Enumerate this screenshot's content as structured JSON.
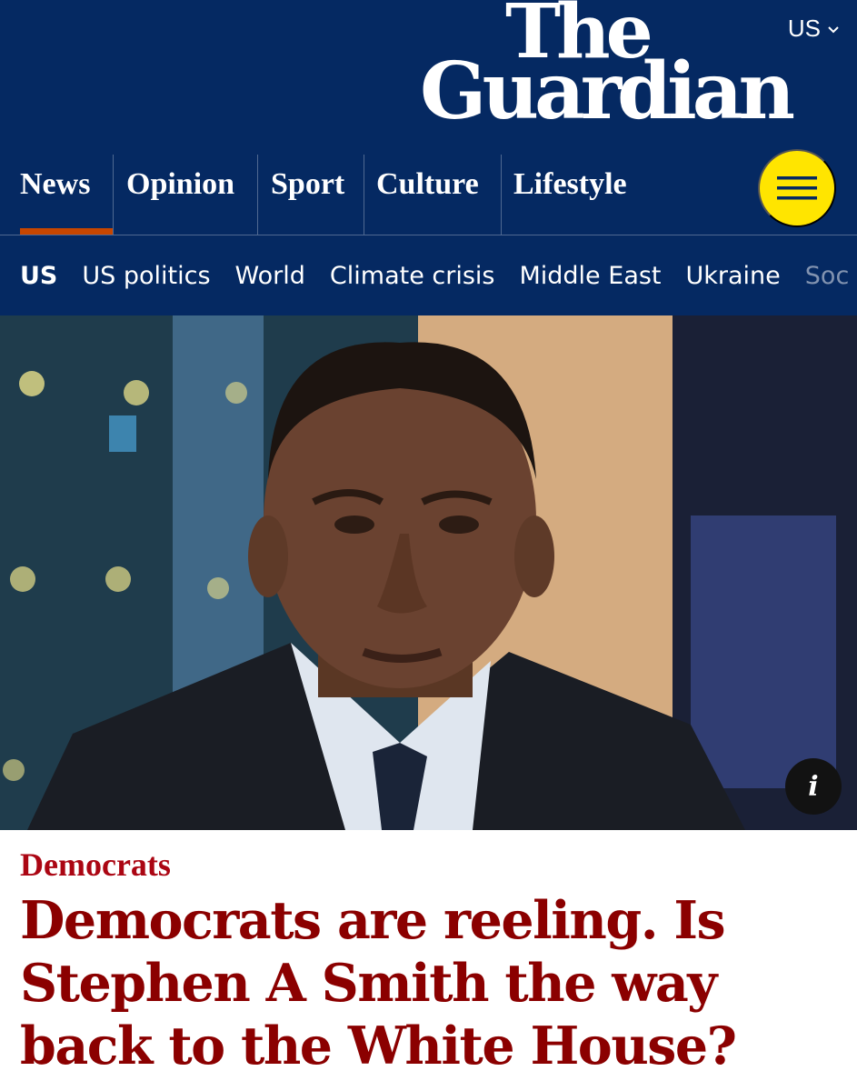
{
  "header": {
    "edition": "US",
    "logo": {
      "line1": "The",
      "line2": "Guardian"
    },
    "pillars": [
      "News",
      "Opinion",
      "Sport",
      "Culture",
      "Lifestyle"
    ],
    "active_pillar": "News",
    "accent_color": "#c74600",
    "background_color": "#052962",
    "menu_button_color": "#ffe500"
  },
  "subnav": {
    "items": [
      "US",
      "US politics",
      "World",
      "Climate crisis",
      "Middle East",
      "Ukraine",
      "Soc"
    ]
  },
  "hero": {
    "info_label": "i"
  },
  "article": {
    "kicker": "Democrats",
    "headline": "Democrats are reeling. Is Stephen A Smith the way back to the White House?",
    "kicker_color": "#ab0613",
    "headline_color": "#8b0000"
  }
}
